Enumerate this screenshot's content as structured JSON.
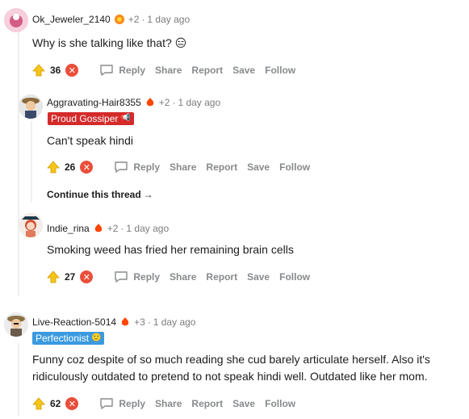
{
  "comments": [
    {
      "username": "Ok_Jeweler_2140",
      "award_count": "+2",
      "separator": "·",
      "time": "1 day ago",
      "body": "Why is she talking like that? 😑",
      "score": "36",
      "actions": [
        "Reply",
        "Share",
        "Report",
        "Save",
        "Follow"
      ]
    },
    {
      "username": "Aggravating-Hair8355",
      "award_count": "+2",
      "separator": "·",
      "time": "1 day ago",
      "flair": "Proud Gossiper",
      "body": "Can't speak hindi",
      "score": "26",
      "actions": [
        "Reply",
        "Share",
        "Report",
        "Save",
        "Follow"
      ]
    },
    {
      "username": "Indie_rina",
      "award_count": "+2",
      "separator": "·",
      "time": "1 day ago",
      "body": "Smoking weed has fried her remaining brain cells",
      "score": "27",
      "actions": [
        "Reply",
        "Share",
        "Report",
        "Save",
        "Follow"
      ]
    },
    {
      "username": "Live-Reaction-5014",
      "award_count": "+3",
      "separator": "·",
      "time": "1 day ago",
      "flair": "Perfectionist",
      "body": "Funny coz despite of so much reading she cud barely articulate herself. Also it's ridiculously outdated to pretend to not speak hindi well. Outdated like her mom.",
      "score": "62",
      "actions": [
        "Reply",
        "Share",
        "Report",
        "Save",
        "Follow"
      ]
    }
  ],
  "continue_thread": "Continue this thread",
  "colors": {
    "upvote": "#f5c518",
    "downvote": "#ea4e3a",
    "flair_red": "#d42a2a",
    "flair_blue": "#3a9ae0",
    "action_gray": "#878a8c"
  },
  "icons": [
    "upvote-icon",
    "downvote-icon",
    "reply-icon",
    "award-icon",
    "arrow-right-icon"
  ]
}
